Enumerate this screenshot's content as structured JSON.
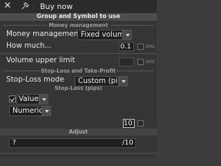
{
  "window": {
    "title": "Buy now"
  },
  "header": {
    "group_title": "Group and Symbol to use"
  },
  "money": {
    "section_title": "Money management",
    "mm_label": "Money management",
    "mm_value": "Fixed volume",
    "how_much_label": "How much...",
    "how_much_value": "0.1",
    "how_much_unit": "lots",
    "upper_limit_label": "Volume upper limit",
    "upper_limit_value": "",
    "upper_limit_unit": "lots"
  },
  "stoploss": {
    "section_title": "Stop-Loss and Take-Profit",
    "mode_label": "Stop-Loss mode",
    "mode_value": "Custom (pips)",
    "pips_title": "Stop-Loss (pips)",
    "type_value": "Value",
    "numeric_value": "Numeric",
    "amount_value": "10",
    "adjust_title": "Adjust",
    "adjust_left": "?",
    "adjust_right": "/10"
  }
}
